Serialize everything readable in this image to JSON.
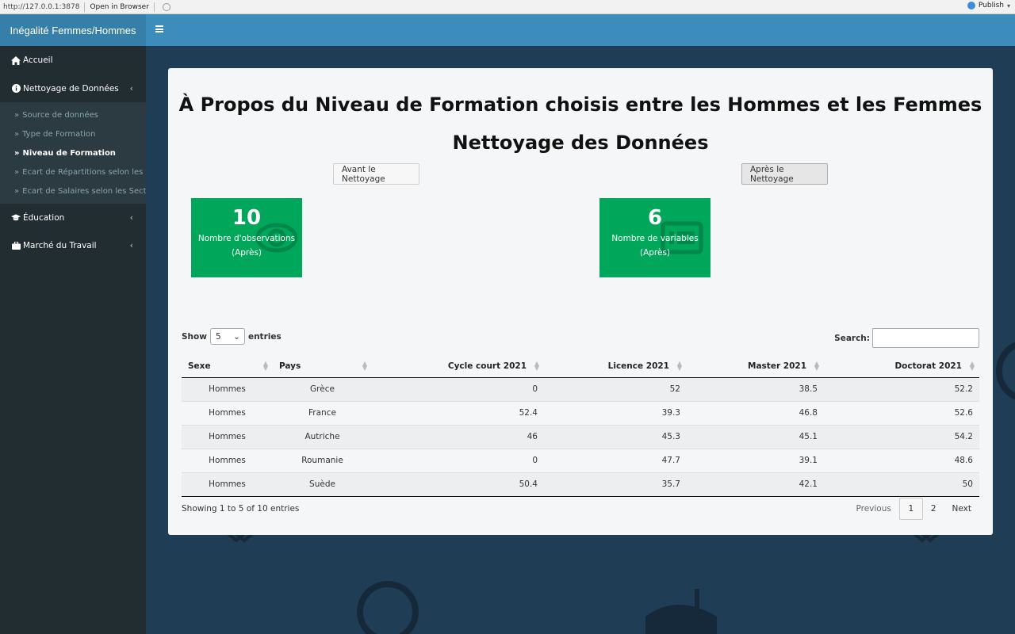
{
  "browser": {
    "url": "http://127.0.0.1:3878",
    "open_in_browser": "Open in Browser",
    "publish": "Publish"
  },
  "brand": "Inégalité Femmes/Hommes",
  "sidebar": {
    "items": [
      {
        "label": "Accueil",
        "icon": "home-icon"
      },
      {
        "label": "Nettoyage de Données",
        "icon": "info-circle-icon"
      },
      {
        "label": "Éducation",
        "icon": "graduation-cap-icon"
      },
      {
        "label": "Marché du Travail",
        "icon": "briefcase-icon"
      }
    ],
    "subitems": [
      {
        "label": "Source de données",
        "active": false
      },
      {
        "label": "Type de Formation",
        "active": false
      },
      {
        "label": "Niveau de Formation",
        "active": true
      },
      {
        "label": "Ecart de Répartitions selon les Se",
        "active": false
      },
      {
        "label": "Ecart de Salaires selon les Secteu",
        "active": false
      }
    ]
  },
  "main": {
    "title": "À Propos du Niveau de Formation choisis entre les Hommes et les Femmes",
    "subtitle": "Nettoyage des Données",
    "btn_before": "Avant le Nettoyage",
    "btn_after": "Après le Nettoyage",
    "valuebox1": {
      "value": "10",
      "label1": "Nombre d'observations",
      "label2": "(Après)",
      "icon": "eye-icon"
    },
    "valuebox2": {
      "value": "6",
      "label1": "Nombre de variables",
      "label2": "(Après)",
      "icon": "list-icon"
    },
    "colors": {
      "valuebox": "#00a65a",
      "header": "#3c8dbc",
      "sidebar": "#222d32"
    }
  },
  "table": {
    "show_label": "Show",
    "entries_value": "5",
    "entries_label": "entries",
    "search_label": "Search:",
    "columns": [
      "Sexe",
      "Pays",
      "Cycle court 2021",
      "Licence 2021",
      "Master 2021",
      "Doctorat 2021"
    ],
    "rows": [
      [
        "Hommes",
        "Grèce",
        "0",
        "52",
        "38.5",
        "52.2"
      ],
      [
        "Hommes",
        "France",
        "52.4",
        "39.3",
        "46.8",
        "52.6"
      ],
      [
        "Hommes",
        "Autriche",
        "46",
        "45.3",
        "45.1",
        "54.2"
      ],
      [
        "Hommes",
        "Roumanie",
        "0",
        "47.7",
        "39.1",
        "48.6"
      ],
      [
        "Hommes",
        "Suède",
        "50.4",
        "35.7",
        "42.1",
        "50"
      ]
    ],
    "info": "Showing 1 to 5 of 10 entries",
    "pagination": {
      "previous": "Previous",
      "pages": [
        "1",
        "2"
      ],
      "next": "Next"
    }
  }
}
